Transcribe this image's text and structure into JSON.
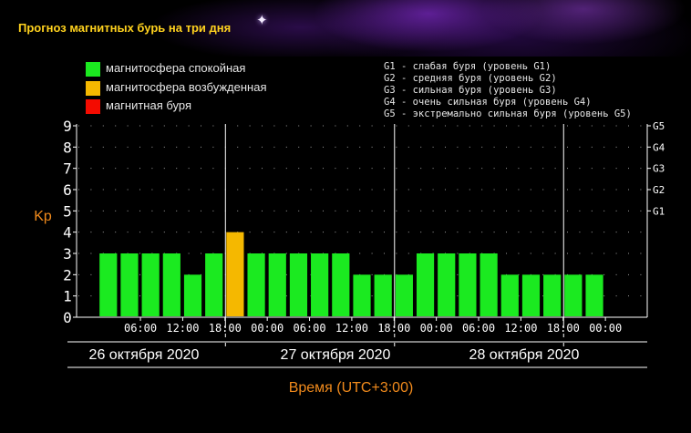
{
  "title": "Прогноз магнитных бурь на три дня",
  "legend": {
    "items": [
      {
        "label": "магнитосфера спокойная",
        "color": "#1bea20"
      },
      {
        "label": "магнитосфера возбужденная",
        "color": "#f5b800"
      },
      {
        "label": "магнитная буря",
        "color": "#f40b00"
      }
    ]
  },
  "g_scale": [
    "G1 - слабая буря (уровень G1)",
    "G2 - средняя буря (уровень G2)",
    "G3 - сильная буря (уровень G3)",
    "G4 - очень сильная буря (уровень G4)",
    "G5 - экстремально сильная буря (уровень G5)"
  ],
  "chart_data": {
    "type": "bar",
    "ylabel": "Kp",
    "xlabel": "Время (UTC+3:00)",
    "ylim": [
      0,
      9
    ],
    "y_ticks": [
      "0",
      "1",
      "2",
      "3",
      "4",
      "5",
      "6",
      "7",
      "8",
      "9"
    ],
    "right_ticks": [
      {
        "kp": 5,
        "label": "G1"
      },
      {
        "kp": 6,
        "label": "G2"
      },
      {
        "kp": 7,
        "label": "G3"
      },
      {
        "kp": 8,
        "label": "G4"
      },
      {
        "kp": 9,
        "label": "G5"
      }
    ],
    "time_ticks": [
      "06:00",
      "12:00",
      "18:00",
      "00:00",
      "06:00",
      "12:00",
      "18:00",
      "00:00",
      "06:00",
      "12:00",
      "18:00",
      "00:00"
    ],
    "days": [
      "26 октября 2020",
      "27 октября 2020",
      "28 октября 2020"
    ],
    "values": [
      3,
      3,
      3,
      3,
      2,
      3,
      4,
      3,
      3,
      3,
      3,
      3,
      2,
      2,
      2,
      3,
      3,
      3,
      3,
      2,
      2,
      2,
      2,
      2
    ],
    "colors": {
      "quiet": "#1bea20",
      "active": "#f5b800",
      "storm": "#f40b00"
    },
    "axis_label_color": "#f08a1c",
    "grid": true
  }
}
